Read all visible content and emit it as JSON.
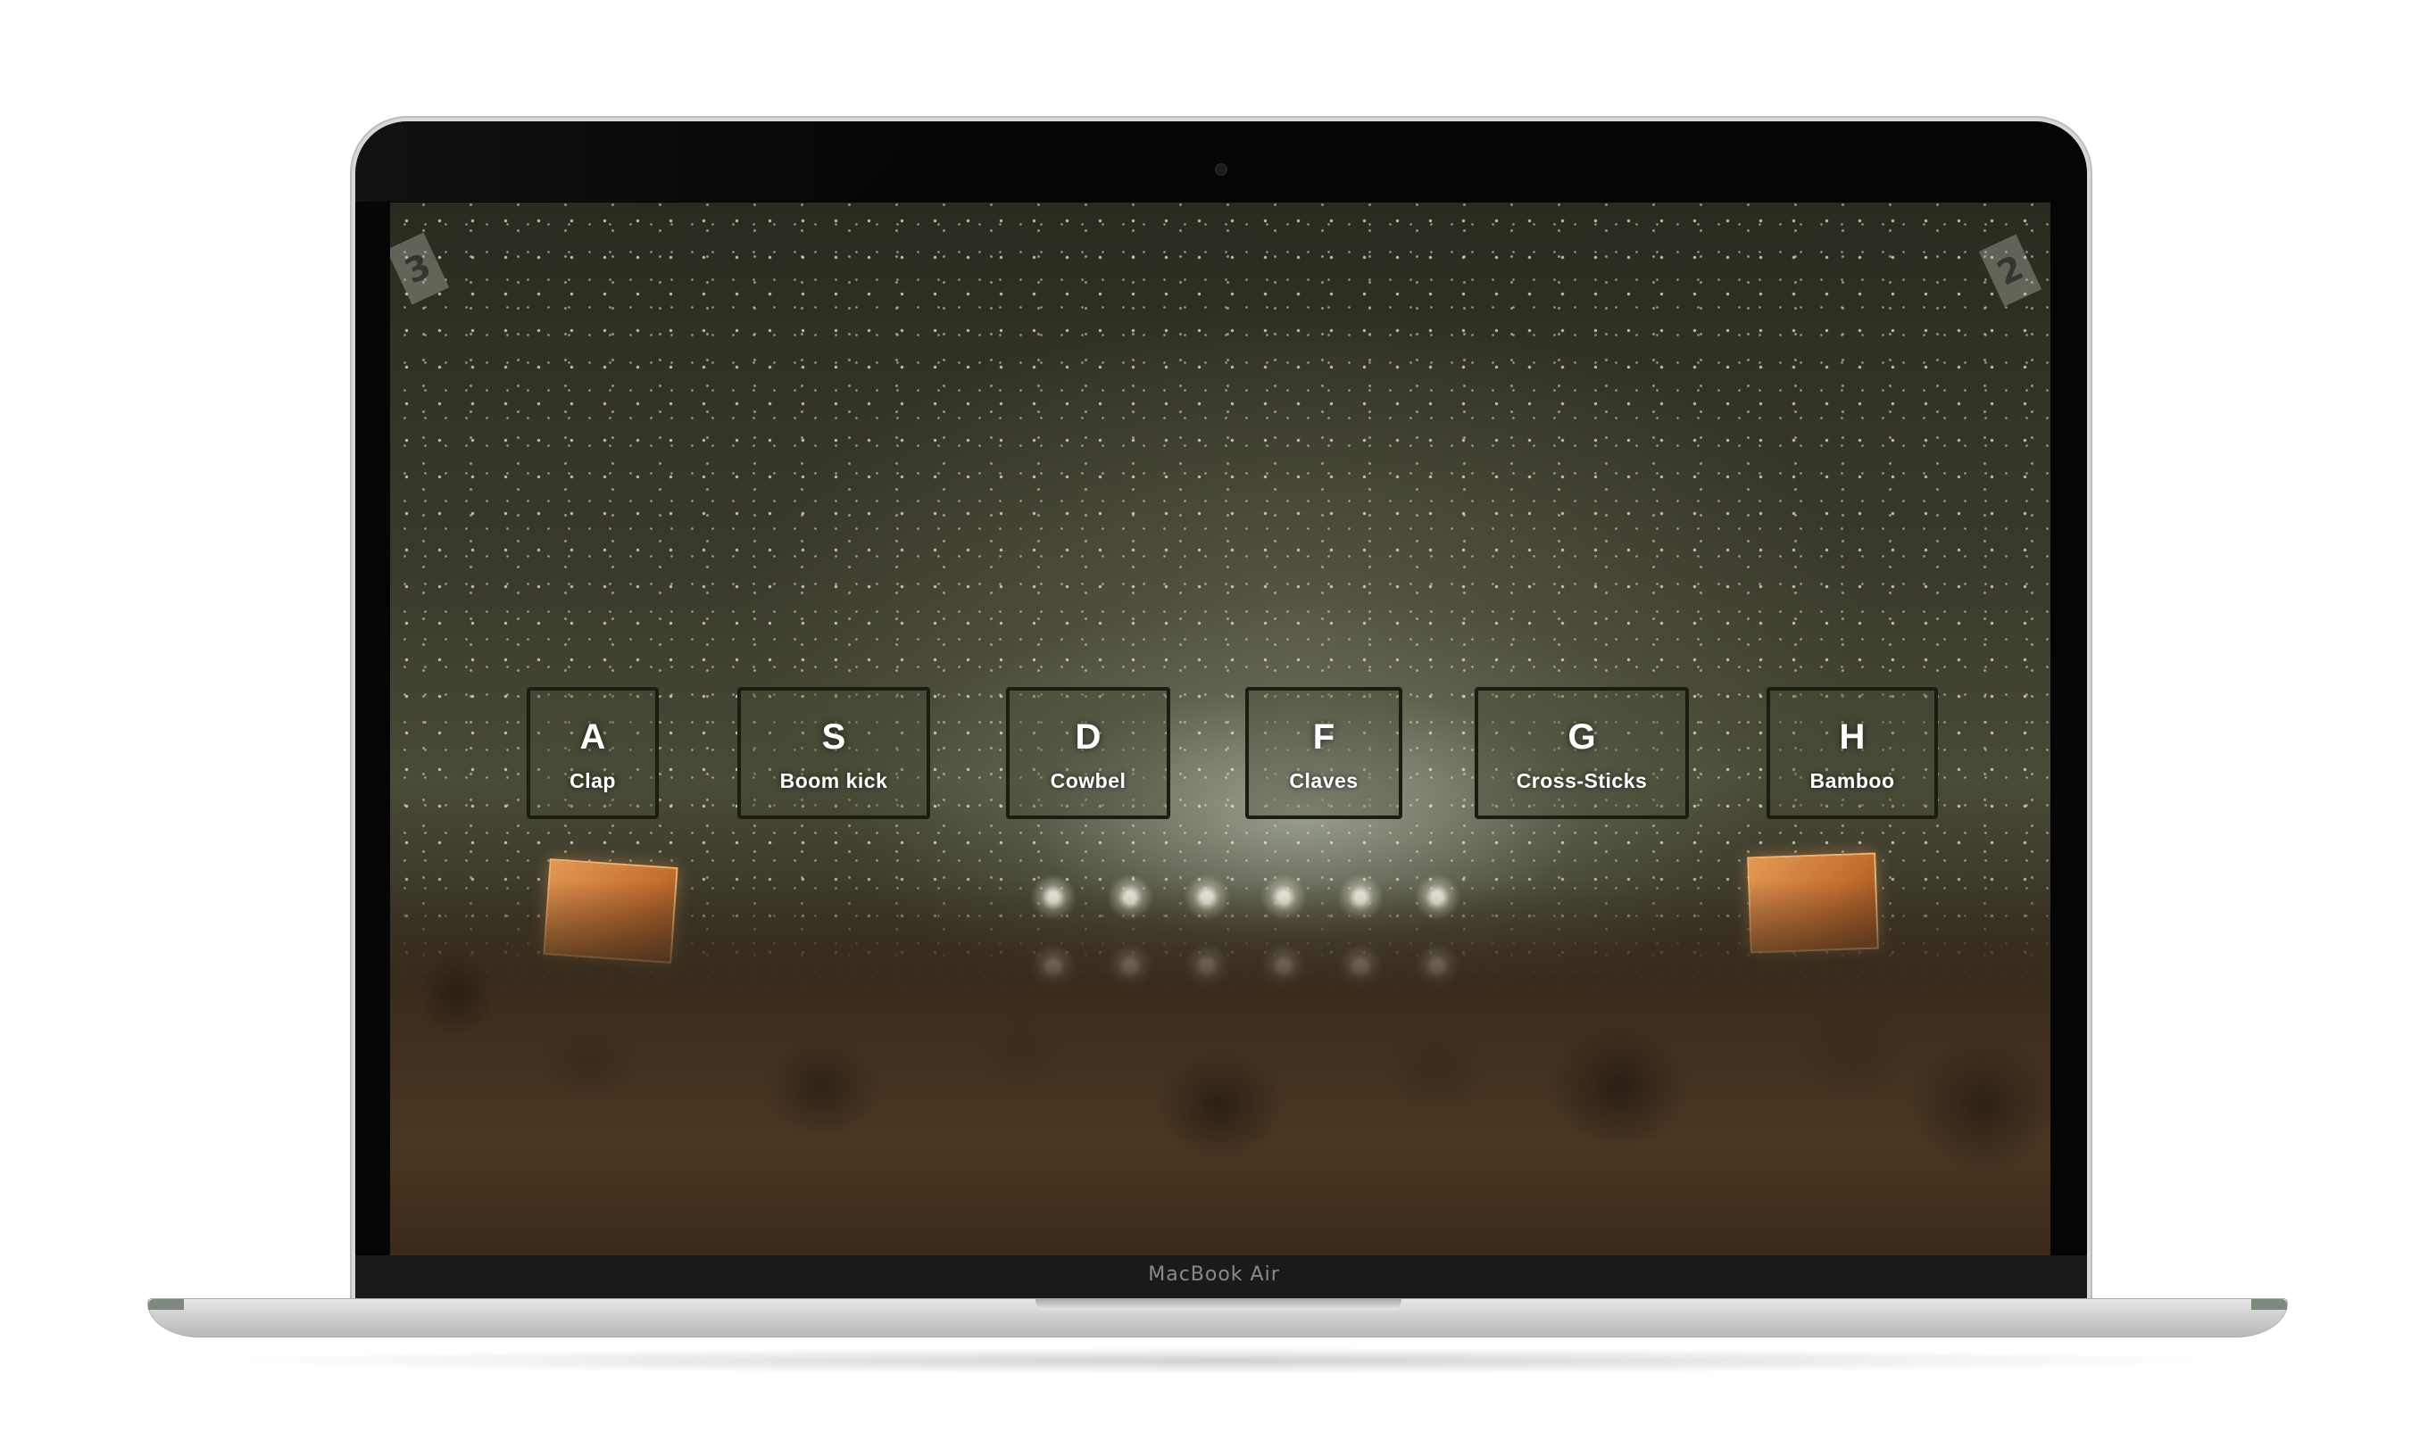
{
  "device": {
    "model_label": "MacBook Air"
  },
  "app": {
    "background": {
      "scene": "concert crowd with confetti",
      "corner_signs": [
        "3",
        "2"
      ]
    },
    "drum_pads": [
      {
        "key": "A",
        "sound": "Clap"
      },
      {
        "key": "S",
        "sound": "Boom kick"
      },
      {
        "key": "D",
        "sound": "Cowbel"
      },
      {
        "key": "F",
        "sound": "Claves"
      },
      {
        "key": "G",
        "sound": "Cross-Sticks"
      },
      {
        "key": "H",
        "sound": "Bamboo"
      }
    ]
  },
  "colors": {
    "pad_border": "#1b1d12",
    "pad_text": "#ffffff",
    "bezel": "#050505"
  }
}
